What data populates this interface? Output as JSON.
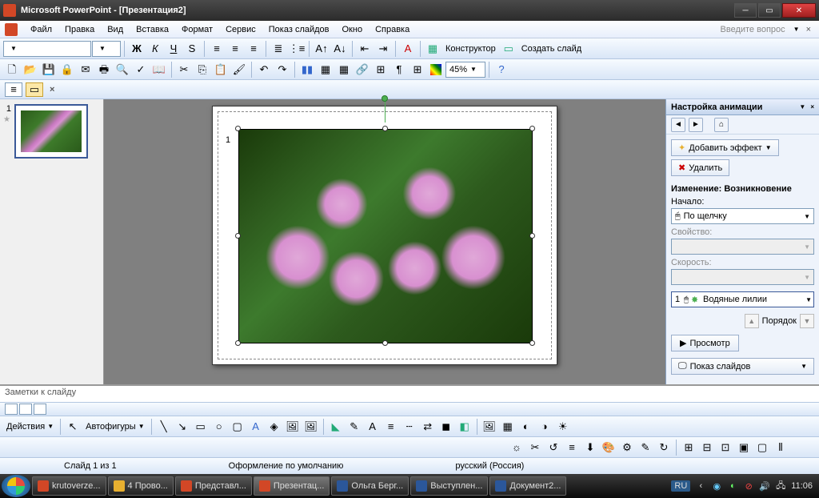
{
  "title": "Microsoft PowerPoint - [Презентация2]",
  "menu": {
    "file": "Файл",
    "edit": "Правка",
    "view": "Вид",
    "insert": "Вставка",
    "format": "Формат",
    "tools": "Сервис",
    "slideshow": "Показ слайдов",
    "window": "Окно",
    "help": "Справка"
  },
  "help_prompt": "Введите вопрос",
  "toolbar": {
    "designer": "Конструктор",
    "new_slide": "Создать слайд"
  },
  "zoom": "45%",
  "slide_number": "1",
  "notes_placeholder": "Заметки к слайду",
  "draw": {
    "actions": "Действия",
    "autoshapes": "Автофигуры"
  },
  "pane": {
    "title": "Настройка анимации",
    "add_effect": "Добавить эффект",
    "delete": "Удалить",
    "change_label": "Изменение: Возникновение",
    "start_label": "Начало:",
    "start_value": "По щелчку",
    "property_label": "Свойство:",
    "speed_label": "Скорость:",
    "item_num": "1",
    "item_name": "Водяные лилии",
    "order": "Порядок",
    "preview": "Просмотр",
    "slideshow": "Показ слайдов"
  },
  "status": {
    "slide": "Слайд 1 из 1",
    "design": "Оформление по умолчанию",
    "lang": "русский (Россия)"
  },
  "taskbar": {
    "items": [
      {
        "label": "krutoverze...",
        "color": "#d24726"
      },
      {
        "label": "4 Прово...",
        "color": "#e8b030"
      },
      {
        "label": "Представл...",
        "color": "#d24726"
      },
      {
        "label": "Презентац...",
        "color": "#d24726"
      },
      {
        "label": "Ольга Берг...",
        "color": "#2b579a"
      },
      {
        "label": "Выступлен...",
        "color": "#2b579a"
      },
      {
        "label": "Документ2...",
        "color": "#2b579a"
      }
    ],
    "lang": "RU",
    "time": "11:06"
  }
}
